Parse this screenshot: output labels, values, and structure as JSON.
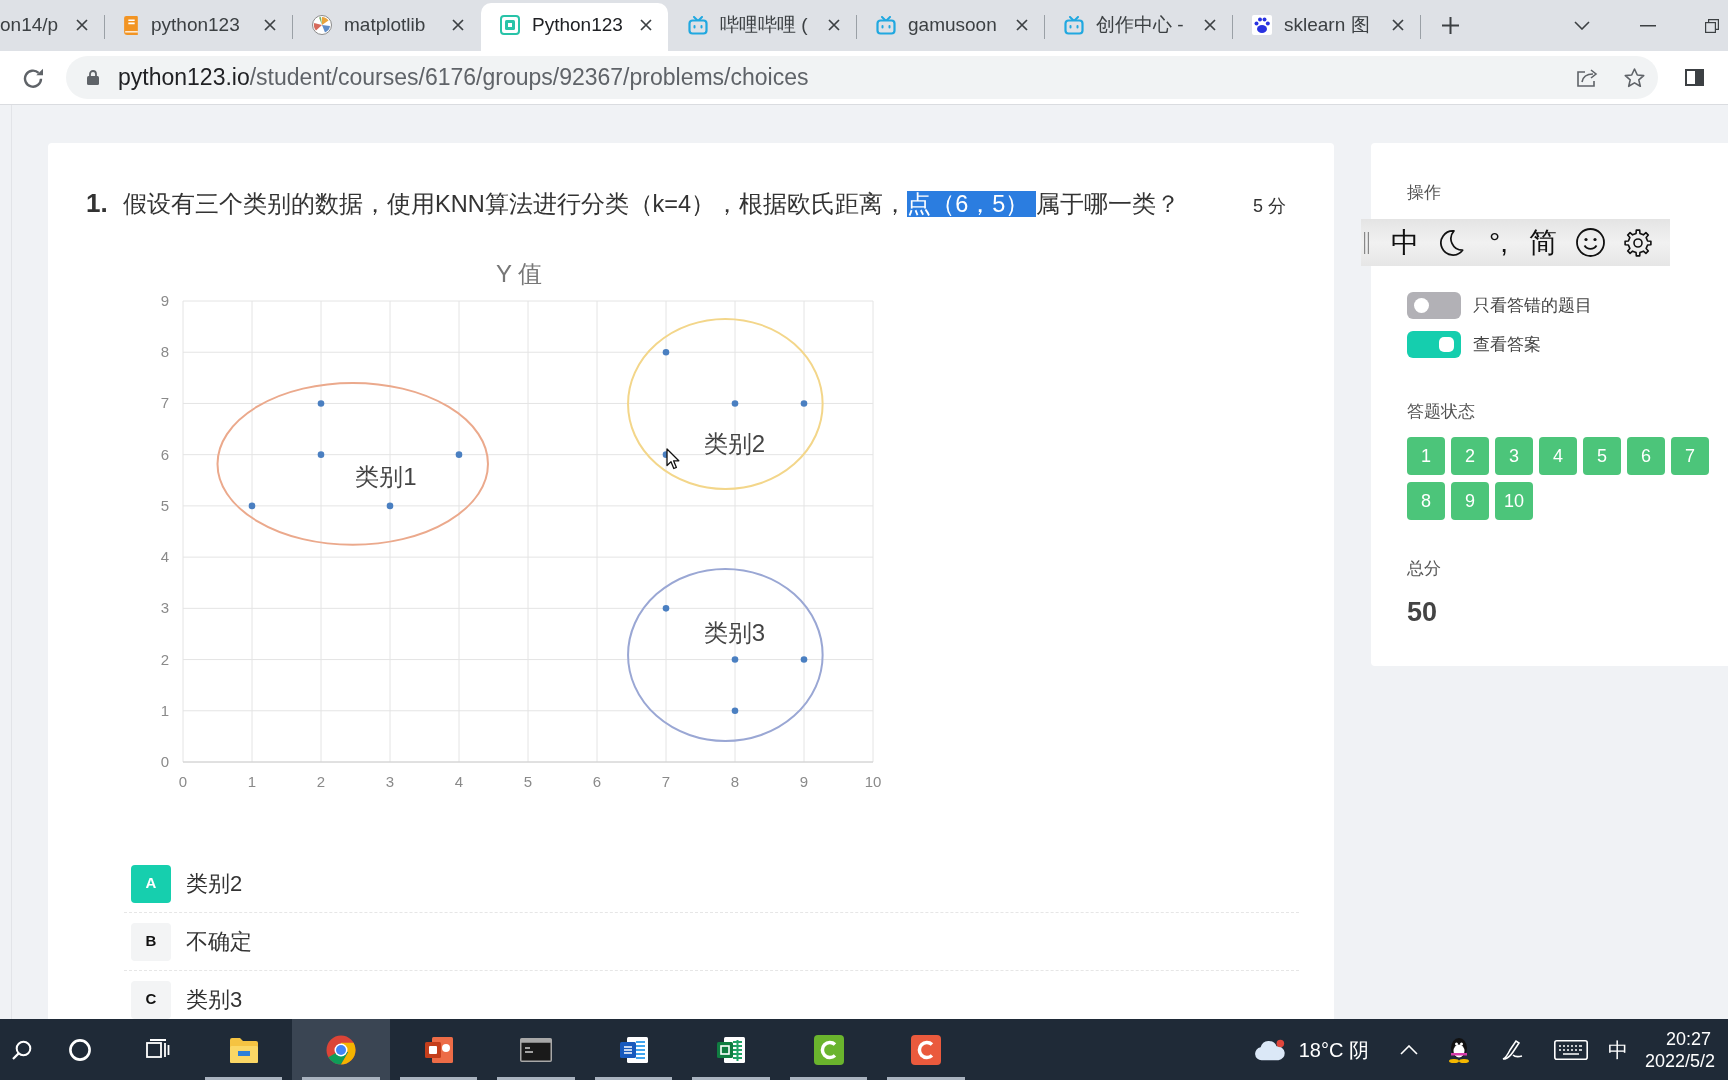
{
  "browser": {
    "tabs": [
      {
        "kind": "partial",
        "title": "on14/p",
        "selected": false
      },
      {
        "kind": "book",
        "title": "python123",
        "selected": false
      },
      {
        "kind": "plot",
        "title": "matplotlib",
        "selected": false
      },
      {
        "kind": "logo",
        "title": "Python123",
        "selected": true
      },
      {
        "kind": "tv",
        "title": "哔哩哔哩 (",
        "selected": false
      },
      {
        "kind": "tv",
        "title": "gamusoon",
        "selected": false
      },
      {
        "kind": "tv",
        "title": "创作中心 -",
        "selected": false
      },
      {
        "kind": "paw",
        "title": "sklearn 图",
        "selected": false
      }
    ],
    "url": {
      "host": "python123.io",
      "path": "/student/courses/6176/groups/92367/problems/choices"
    }
  },
  "question": {
    "number": "1.",
    "segments": [
      {
        "text": "假设有三个类别的数据，使用KNN算法进行分类（k=4），根据欧氏距离，",
        "highlighted": false
      },
      {
        "text": "点（6，5）",
        "highlighted": true
      },
      {
        "text": "属于哪一类？",
        "highlighted": false
      }
    ],
    "score": "5 分",
    "chart_data": [
      {
        "type": "scatter",
        "title": "Y 值",
        "x": [
          1,
          2,
          2,
          3,
          4,
          7,
          7,
          8,
          9,
          7,
          8,
          9,
          8
        ],
        "values": [
          5,
          6,
          7,
          5,
          6,
          8,
          6,
          7,
          7,
          3,
          2,
          2,
          1
        ],
        "color": "#4a7fc1",
        "xlim": [
          0,
          10
        ],
        "ylim": [
          0,
          9
        ],
        "xticks": [
          0,
          1,
          2,
          3,
          4,
          5,
          6,
          7,
          8,
          9,
          10
        ],
        "yticks": [
          0,
          1,
          2,
          3,
          4,
          5,
          6,
          7,
          8,
          9
        ],
        "grid": true,
        "annotations": [
          "类别1",
          "类别2",
          "类别3"
        ]
      }
    ]
  },
  "options": [
    {
      "letter": "A",
      "text": "类别2",
      "selected": true
    },
    {
      "letter": "B",
      "text": "不确定",
      "selected": false
    },
    {
      "letter": "C",
      "text": "类别3",
      "selected": false
    }
  ],
  "panel": {
    "operations_label": "操作",
    "toggles": [
      {
        "label": "只看答错的题目",
        "on": false
      },
      {
        "label": "查看答案",
        "on": true
      }
    ],
    "status_label": "答题状态",
    "status_buttons": [
      {
        "label": "1",
        "answered": true
      },
      {
        "label": "2",
        "answered": true
      },
      {
        "label": "3",
        "answered": true
      },
      {
        "label": "4",
        "answered": true
      },
      {
        "label": "5",
        "answered": true
      },
      {
        "label": "6",
        "answered": true
      },
      {
        "label": "7",
        "answered": true
      },
      {
        "label": "8",
        "answered": true
      },
      {
        "label": "9",
        "answered": true
      },
      {
        "label": "10",
        "answered": true
      }
    ],
    "total_label": "总分",
    "total": "50"
  },
  "ime_toolbar": {
    "mode": "中",
    "punctuation": "°,",
    "script": "简"
  },
  "taskbar": {
    "apps": [
      {
        "kind": "folder",
        "selected": false,
        "running": true
      },
      {
        "kind": "browser",
        "selected": true,
        "running": true
      },
      {
        "kind": "slides",
        "selected": false,
        "running": true
      },
      {
        "kind": "terminal",
        "selected": false,
        "running": true
      },
      {
        "kind": "docs",
        "selected": false,
        "running": true
      },
      {
        "kind": "sheets",
        "selected": false,
        "running": true
      },
      {
        "kind": "recorder",
        "selected": false,
        "running": true
      },
      {
        "kind": "editor",
        "selected": false,
        "running": true
      }
    ],
    "weather": "18°C 阴",
    "input_method": "中",
    "time": "20:27",
    "date": "2022/5/2"
  }
}
